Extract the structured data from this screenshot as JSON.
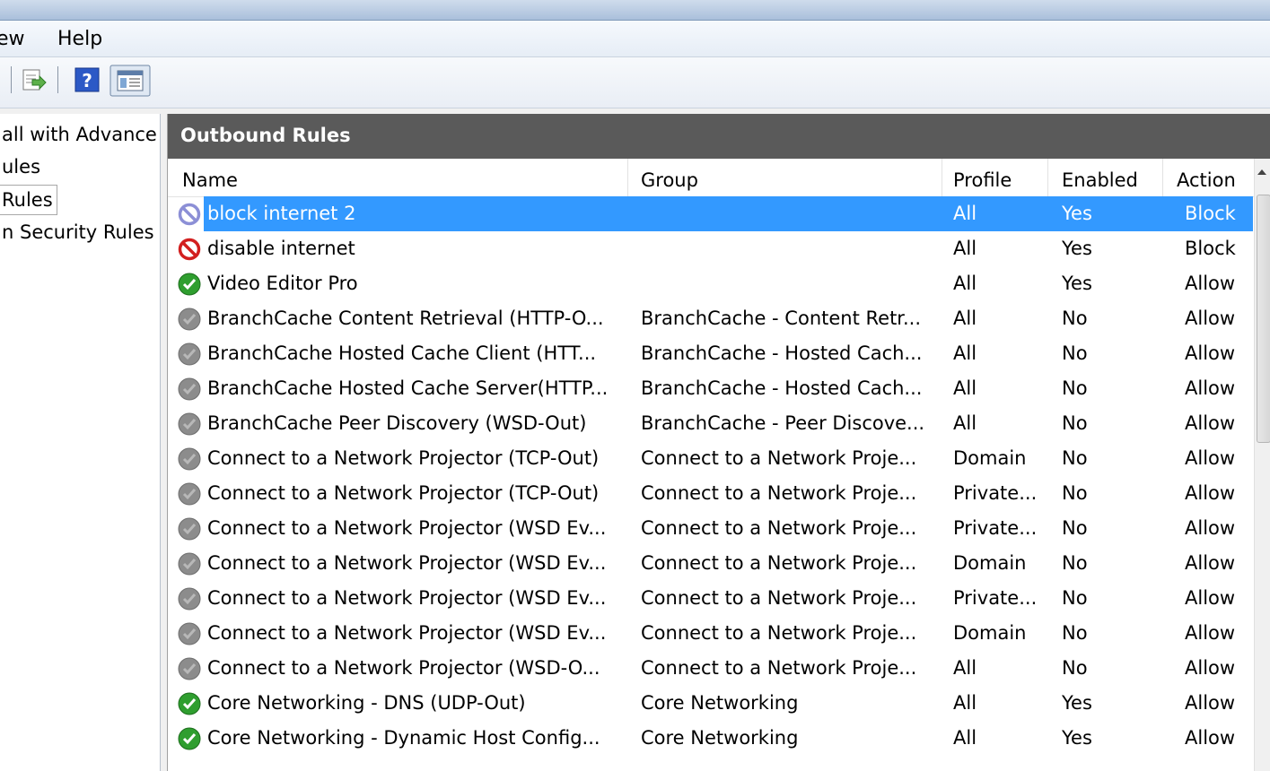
{
  "menu": {
    "view_label": "ew",
    "help_label": "Help"
  },
  "tree": {
    "items": [
      {
        "label": "all with Advance"
      },
      {
        "label": "ules"
      },
      {
        "label": "Rules"
      },
      {
        "label": "n Security Rules"
      }
    ]
  },
  "pane": {
    "title": "Outbound Rules",
    "columns": {
      "name": "Name",
      "group": "Group",
      "profile": "Profile",
      "enabled": "Enabled",
      "action": "Action"
    },
    "rows": [
      {
        "name": "block internet 2",
        "group": "",
        "profile": "All",
        "enabled": "Yes",
        "action": "Block",
        "icon": "blocked-disabled-icon"
      },
      {
        "name": "disable internet",
        "group": "",
        "profile": "All",
        "enabled": "Yes",
        "action": "Block",
        "icon": "block-icon"
      },
      {
        "name": "Video Editor Pro",
        "group": "",
        "profile": "All",
        "enabled": "Yes",
        "action": "Allow",
        "icon": "allow-check-icon"
      },
      {
        "name": "BranchCache Content Retrieval (HTTP-O...",
        "group": "BranchCache - Content Retr...",
        "profile": "All",
        "enabled": "No",
        "action": "Allow",
        "icon": "disabled-rule-icon"
      },
      {
        "name": "BranchCache Hosted Cache Client (HTT...",
        "group": "BranchCache - Hosted Cach...",
        "profile": "All",
        "enabled": "No",
        "action": "Allow",
        "icon": "disabled-rule-icon"
      },
      {
        "name": "BranchCache Hosted Cache Server(HTTP...",
        "group": "BranchCache - Hosted Cach...",
        "profile": "All",
        "enabled": "No",
        "action": "Allow",
        "icon": "disabled-rule-icon"
      },
      {
        "name": "BranchCache Peer Discovery (WSD-Out)",
        "group": "BranchCache - Peer Discove...",
        "profile": "All",
        "enabled": "No",
        "action": "Allow",
        "icon": "disabled-rule-icon"
      },
      {
        "name": "Connect to a Network Projector (TCP-Out)",
        "group": "Connect to a Network Proje...",
        "profile": "Domain",
        "enabled": "No",
        "action": "Allow",
        "icon": "disabled-rule-icon"
      },
      {
        "name": "Connect to a Network Projector (TCP-Out)",
        "group": "Connect to a Network Proje...",
        "profile": "Private...",
        "enabled": "No",
        "action": "Allow",
        "icon": "disabled-rule-icon"
      },
      {
        "name": "Connect to a Network Projector (WSD Ev...",
        "group": "Connect to a Network Proje...",
        "profile": "Private...",
        "enabled": "No",
        "action": "Allow",
        "icon": "disabled-rule-icon"
      },
      {
        "name": "Connect to a Network Projector (WSD Ev...",
        "group": "Connect to a Network Proje...",
        "profile": "Domain",
        "enabled": "No",
        "action": "Allow",
        "icon": "disabled-rule-icon"
      },
      {
        "name": "Connect to a Network Projector (WSD Ev...",
        "group": "Connect to a Network Proje...",
        "profile": "Private...",
        "enabled": "No",
        "action": "Allow",
        "icon": "disabled-rule-icon"
      },
      {
        "name": "Connect to a Network Projector (WSD Ev...",
        "group": "Connect to a Network Proje...",
        "profile": "Domain",
        "enabled": "No",
        "action": "Allow",
        "icon": "disabled-rule-icon"
      },
      {
        "name": "Connect to a Network Projector (WSD-O...",
        "group": "Connect to a Network Proje...",
        "profile": "All",
        "enabled": "No",
        "action": "Allow",
        "icon": "disabled-rule-icon"
      },
      {
        "name": "Core Networking - DNS (UDP-Out)",
        "group": "Core Networking",
        "profile": "All",
        "enabled": "Yes",
        "action": "Allow",
        "icon": "allow-check-icon"
      },
      {
        "name": "Core Networking - Dynamic Host Config...",
        "group": "Core Networking",
        "profile": "All",
        "enabled": "Yes",
        "action": "Allow",
        "icon": "allow-check-icon"
      }
    ]
  },
  "colors": {
    "selection": "#3399ff",
    "header_bg": "#5a5a5a",
    "allow_green": "#2f9e2f",
    "block_red": "#d21f1f",
    "disabled_gray": "#8c8c8c"
  }
}
